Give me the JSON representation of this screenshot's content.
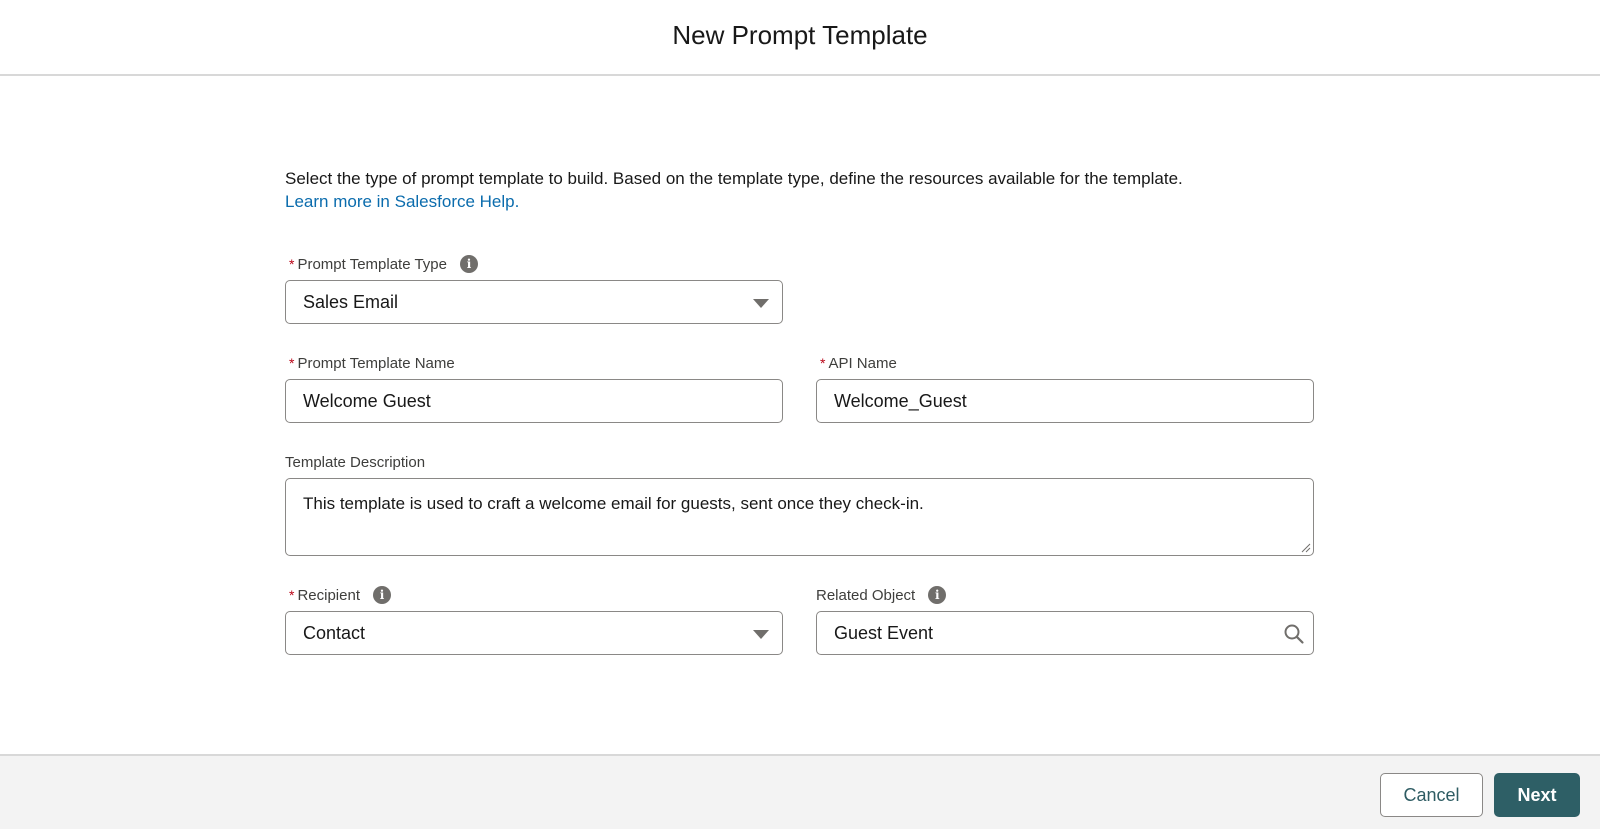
{
  "header": {
    "title": "New Prompt Template"
  },
  "intro": {
    "text": "Select the type of prompt template to build. Based on the template type, define the resources available for the template.",
    "link": "Learn more in Salesforce Help."
  },
  "fields": {
    "type": {
      "label": "Prompt Template Type",
      "required": "*",
      "value": "Sales Email",
      "icon": "info-icon"
    },
    "name": {
      "label": "Prompt Template Name",
      "required": "*",
      "value": "Welcome Guest"
    },
    "api_name": {
      "label": "API Name",
      "required": "*",
      "value": "Welcome_Guest"
    },
    "description": {
      "label": "Template Description",
      "value": "This template is used to craft a welcome email for guests, sent once they check-in."
    },
    "recipient": {
      "label": "Recipient",
      "required": "*",
      "value": "Contact",
      "icon": "info-icon"
    },
    "related_object": {
      "label": "Related Object",
      "value": "Guest Event",
      "icon": "search-icon"
    }
  },
  "footer": {
    "cancel_label": "Cancel",
    "next_label": "Next"
  },
  "colors": {
    "brand_button": "#2e5f66",
    "link": "#0b6cad",
    "required": "#ba0517"
  }
}
